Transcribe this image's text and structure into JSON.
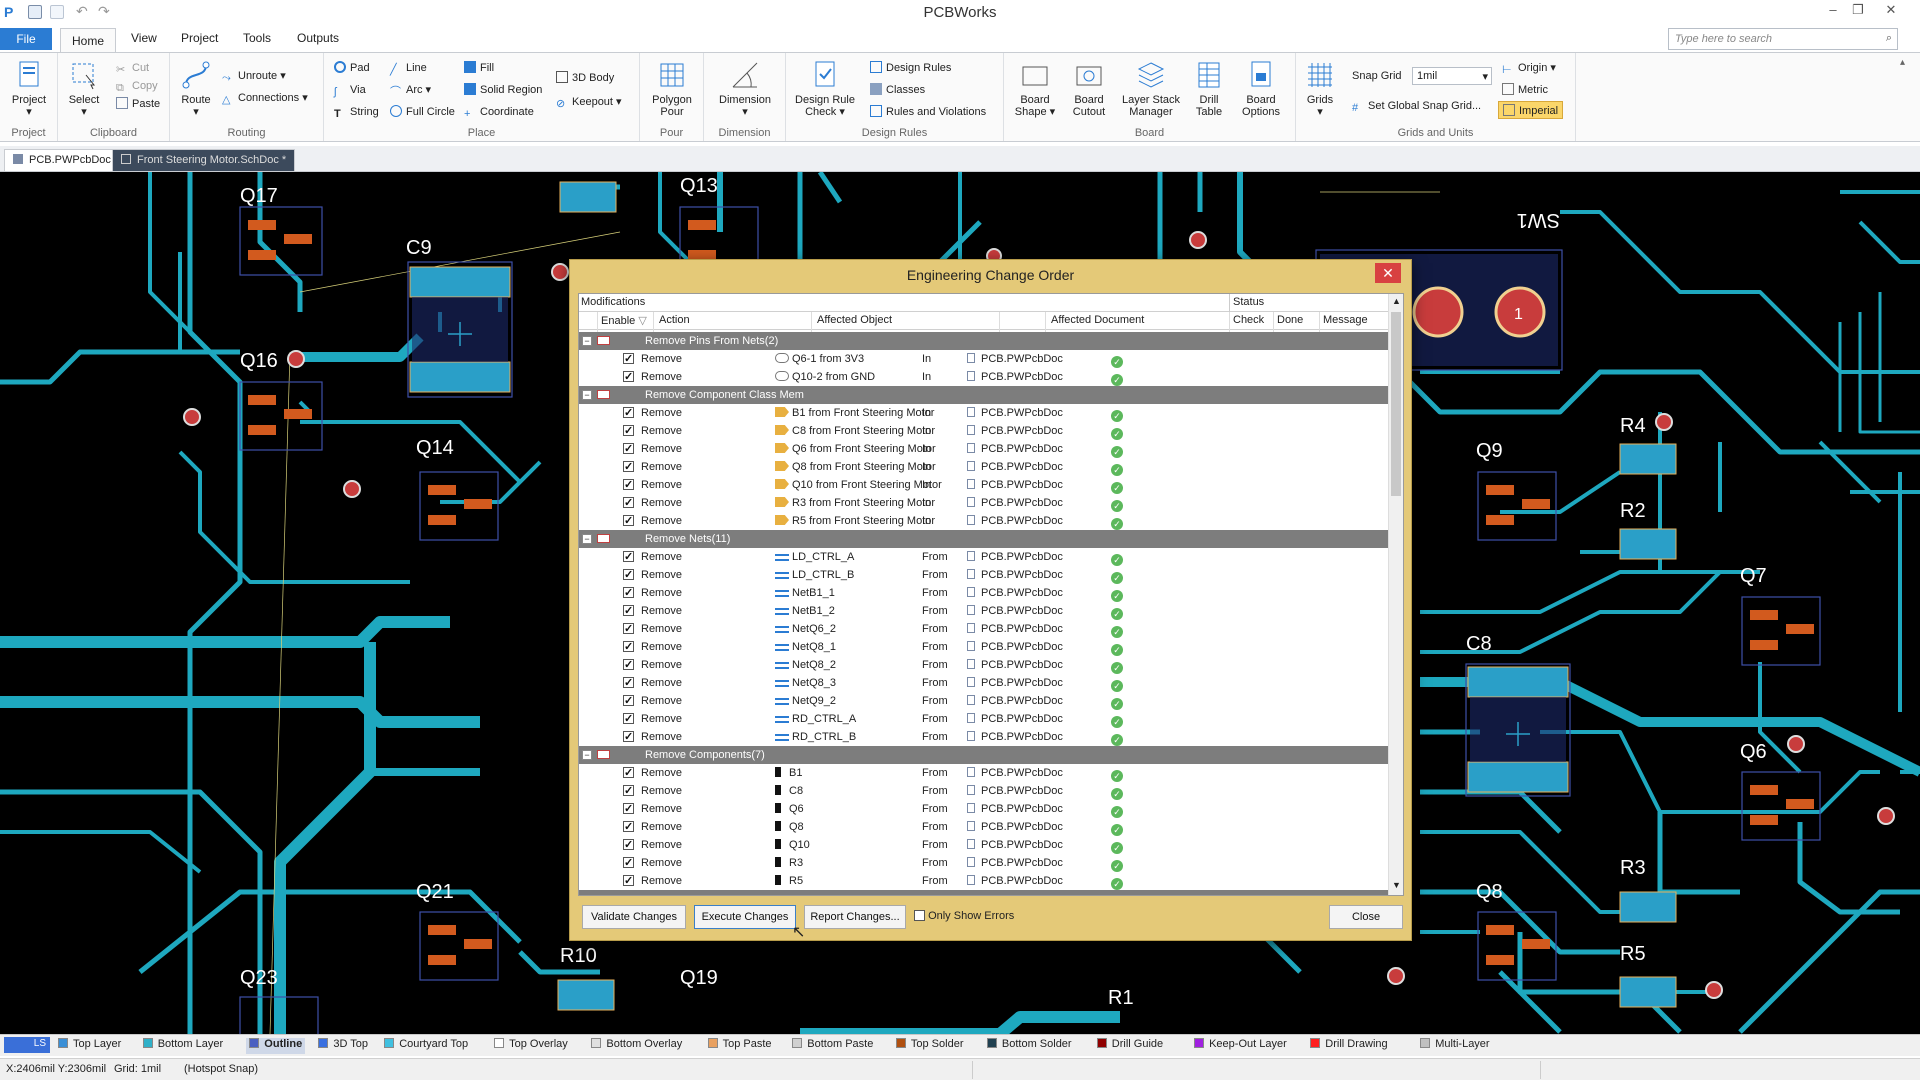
{
  "app": {
    "title": "PCBWorks"
  },
  "menu": {
    "file": "File",
    "home": "Home",
    "view": "View",
    "project": "Project",
    "tools": "Tools",
    "outputs": "Outputs"
  },
  "search": {
    "placeholder": "Type here to search"
  },
  "ribbon": {
    "project": {
      "big": "Project",
      "label": "Project"
    },
    "clipboard": {
      "select": "Select",
      "cut": "Cut",
      "copy": "Copy",
      "paste": "Paste",
      "label": "Clipboard"
    },
    "routing": {
      "route": "Route",
      "unroute": "Unroute",
      "connections": "Connections",
      "label": "Routing"
    },
    "place": {
      "pad": "Pad",
      "via": "Via",
      "string": "String",
      "line": "Line",
      "arc": "Arc",
      "full_circle": "Full Circle",
      "fill": "Fill",
      "solid_region": "Solid Region",
      "coordinate": "Coordinate",
      "body3d": "3D Body",
      "keepout": "Keepout",
      "label": "Place"
    },
    "pour": {
      "polygon": "Polygon",
      "polygon2": "Pour",
      "label": "Pour"
    },
    "dimension": {
      "big": "Dimension",
      "label": "Dimension"
    },
    "design_rules": {
      "drc1": "Design Rule",
      "drc2": "Check",
      "rules": "Design Rules",
      "classes": "Classes",
      "violations": "Rules and Violations",
      "label": "Design Rules"
    },
    "board": {
      "shape1": "Board",
      "shape2": "Shape",
      "cutout1": "Board",
      "cutout2": "Cutout",
      "stack1": "Layer Stack",
      "stack2": "Manager",
      "drill1": "Drill",
      "drill2": "Table",
      "opt1": "Board",
      "opt2": "Options",
      "label": "Board"
    },
    "grids": {
      "grids": "Grids",
      "snap_label": "Snap Grid",
      "snap_value": "1mil",
      "global": "Set Global Snap Grid...",
      "origin": "Origin",
      "metric": "Metric",
      "imperial": "Imperial",
      "label": "Grids and Units"
    }
  },
  "tabs": [
    {
      "label": "PCB.PWPcbDoc"
    },
    {
      "label": "Front Steering Motor.SchDoc *"
    }
  ],
  "pcb_labels": {
    "q17": "Q17",
    "q16": "Q16",
    "q14": "Q14",
    "q13": "Q13",
    "c9": "C9",
    "sw1": "SW1",
    "r4": "R4",
    "r2": "R2",
    "q9": "Q9",
    "q7": "Q7",
    "c8": "C8",
    "q6": "Q6",
    "r3": "R3",
    "r5": "R5",
    "q8": "Q8",
    "q21": "Q21",
    "q23": "Q23",
    "r10": "R10",
    "q19": "Q19",
    "r1": "R1",
    "pad1": "1"
  },
  "eco": {
    "title": "Engineering Change Order",
    "hdr_mod": "Modifications",
    "hdr_status": "Status",
    "cols": {
      "enable": "Enable",
      "action": "Action",
      "object": "Affected Object",
      "document": "Affected Document",
      "check": "Check",
      "done": "Done",
      "message": "Message"
    },
    "groups": [
      {
        "title": "Remove Pins From Nets(2)",
        "rows": [
          {
            "action": "Remove",
            "object": "Q6-1 from 3V3",
            "dir": "In",
            "doc": "PCB.PWPcbDoc"
          },
          {
            "action": "Remove",
            "object": "Q10-2 from GND",
            "dir": "In",
            "doc": "PCB.PWPcbDoc"
          }
        ]
      },
      {
        "title": "Remove Component Class Mem",
        "rows": [
          {
            "action": "Remove",
            "object": "B1 from Front Steering Motor",
            "dir": "In",
            "doc": "PCB.PWPcbDoc"
          },
          {
            "action": "Remove",
            "object": "C8 from Front Steering Motor",
            "dir": "In",
            "doc": "PCB.PWPcbDoc"
          },
          {
            "action": "Remove",
            "object": "Q6 from Front Steering Motor",
            "dir": "In",
            "doc": "PCB.PWPcbDoc"
          },
          {
            "action": "Remove",
            "object": "Q8 from Front Steering Motor",
            "dir": "In",
            "doc": "PCB.PWPcbDoc"
          },
          {
            "action": "Remove",
            "object": "Q10 from Front Steering Motor",
            "dir": "In",
            "doc": "PCB.PWPcbDoc"
          },
          {
            "action": "Remove",
            "object": "R3 from Front Steering Motor",
            "dir": "In",
            "doc": "PCB.PWPcbDoc"
          },
          {
            "action": "Remove",
            "object": "R5 from Front Steering Motor",
            "dir": "In",
            "doc": "PCB.PWPcbDoc"
          }
        ]
      },
      {
        "title": "Remove Nets(11)",
        "rows": [
          {
            "action": "Remove",
            "object": "LD_CTRL_A",
            "dir": "From",
            "doc": "PCB.PWPcbDoc"
          },
          {
            "action": "Remove",
            "object": "LD_CTRL_B",
            "dir": "From",
            "doc": "PCB.PWPcbDoc"
          },
          {
            "action": "Remove",
            "object": "NetB1_1",
            "dir": "From",
            "doc": "PCB.PWPcbDoc"
          },
          {
            "action": "Remove",
            "object": "NetB1_2",
            "dir": "From",
            "doc": "PCB.PWPcbDoc"
          },
          {
            "action": "Remove",
            "object": "NetQ6_2",
            "dir": "From",
            "doc": "PCB.PWPcbDoc"
          },
          {
            "action": "Remove",
            "object": "NetQ8_1",
            "dir": "From",
            "doc": "PCB.PWPcbDoc"
          },
          {
            "action": "Remove",
            "object": "NetQ8_2",
            "dir": "From",
            "doc": "PCB.PWPcbDoc"
          },
          {
            "action": "Remove",
            "object": "NetQ8_3",
            "dir": "From",
            "doc": "PCB.PWPcbDoc"
          },
          {
            "action": "Remove",
            "object": "NetQ9_2",
            "dir": "From",
            "doc": "PCB.PWPcbDoc"
          },
          {
            "action": "Remove",
            "object": "RD_CTRL_A",
            "dir": "From",
            "doc": "PCB.PWPcbDoc"
          },
          {
            "action": "Remove",
            "object": "RD_CTRL_B",
            "dir": "From",
            "doc": "PCB.PWPcbDoc"
          }
        ]
      },
      {
        "title": "Remove Components(7)",
        "rows": [
          {
            "action": "Remove",
            "object": "B1",
            "dir": "From",
            "doc": "PCB.PWPcbDoc"
          },
          {
            "action": "Remove",
            "object": "C8",
            "dir": "From",
            "doc": "PCB.PWPcbDoc"
          },
          {
            "action": "Remove",
            "object": "Q6",
            "dir": "From",
            "doc": "PCB.PWPcbDoc"
          },
          {
            "action": "Remove",
            "object": "Q8",
            "dir": "From",
            "doc": "PCB.PWPcbDoc"
          },
          {
            "action": "Remove",
            "object": "Q10",
            "dir": "From",
            "doc": "PCB.PWPcbDoc"
          },
          {
            "action": "Remove",
            "object": "R3",
            "dir": "From",
            "doc": "PCB.PWPcbDoc"
          },
          {
            "action": "Remove",
            "object": "R5",
            "dir": "From",
            "doc": "PCB.PWPcbDoc"
          }
        ]
      }
    ],
    "buttons": {
      "validate": "Validate Changes",
      "execute": "Execute Changes",
      "report": "Report Changes...",
      "only_errors": "Only Show Errors",
      "close": "Close"
    }
  },
  "layers": [
    {
      "name": "Top Layer",
      "color": "#3a8fd6"
    },
    {
      "name": "Bottom Layer",
      "color": "#30b0c8"
    },
    {
      "name": "Outline",
      "color": "#4a5fc1"
    },
    {
      "name": "3D Top",
      "color": "#3a70e0"
    },
    {
      "name": "Courtyard Top",
      "color": "#40c0e0"
    },
    {
      "name": "Top Overlay",
      "color": "#ffffff"
    },
    {
      "name": "Bottom Overlay",
      "color": "#e0e0e0"
    },
    {
      "name": "Top Paste",
      "color": "#e8a060"
    },
    {
      "name": "Bottom Paste",
      "color": "#d0d0d0"
    },
    {
      "name": "Top Solder",
      "color": "#b05010"
    },
    {
      "name": "Bottom Solder",
      "color": "#204050"
    },
    {
      "name": "Drill Guide",
      "color": "#900000"
    },
    {
      "name": "Keep-Out Layer",
      "color": "#a020e0"
    },
    {
      "name": "Drill Drawing",
      "color": "#ff2020"
    },
    {
      "name": "Multi-Layer",
      "color": "#c0c0c0"
    }
  ],
  "layer_set": "LS",
  "status": {
    "coords": "X:2406mil Y:2306mil",
    "grid": "Grid: 1mil",
    "snap": "(Hotspot Snap)"
  },
  "colors": {
    "trace": "#1ea8bf",
    "via": "#c83c3c",
    "pad": "#2a9fc8",
    "board": "#000000"
  }
}
